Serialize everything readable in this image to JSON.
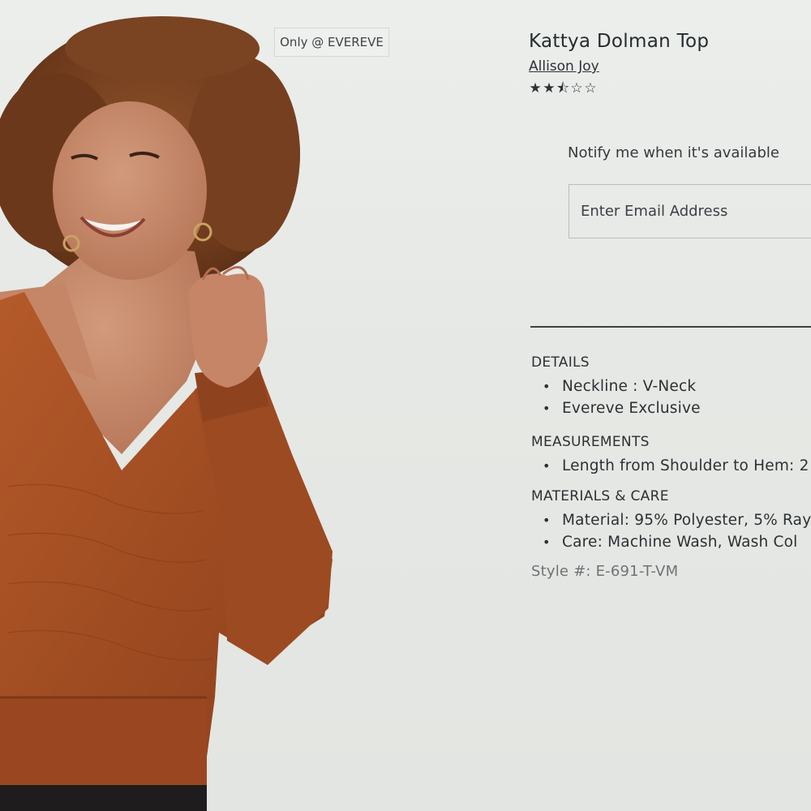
{
  "badge": {
    "label": "Only @ EVEREVE"
  },
  "product": {
    "title": "Kattya Dolman Top",
    "brand": "Allison Joy",
    "rating": {
      "value": 2.5,
      "max": 5,
      "stars": [
        "★",
        "★",
        "⯪",
        "☆",
        "☆"
      ]
    }
  },
  "notify": {
    "label": "Notify me when it's available",
    "email_placeholder": "Enter Email Address"
  },
  "details": {
    "heading": "DETAILS",
    "items": [
      "Neckline : V-Neck",
      "Evereve Exclusive"
    ]
  },
  "measurements": {
    "heading": "MEASUREMENTS",
    "items": [
      "Length from Shoulder to Hem: 2"
    ]
  },
  "materials": {
    "heading": "MATERIALS & CARE",
    "items": [
      "Material: 95% Polyester, 5% Ray",
      "Care: Machine Wash, Wash Col"
    ]
  },
  "style": {
    "label": "Style #: E-691-T-VM"
  },
  "colors": {
    "background": "#e7e9e6",
    "text": "#262c30",
    "muted_text": "#6d7376",
    "top_rust": "#a24f25",
    "hair": "#7a4322"
  },
  "icons": {
    "star_full": "star-full-icon",
    "star_half": "star-half-icon",
    "star_empty": "star-empty-icon"
  }
}
